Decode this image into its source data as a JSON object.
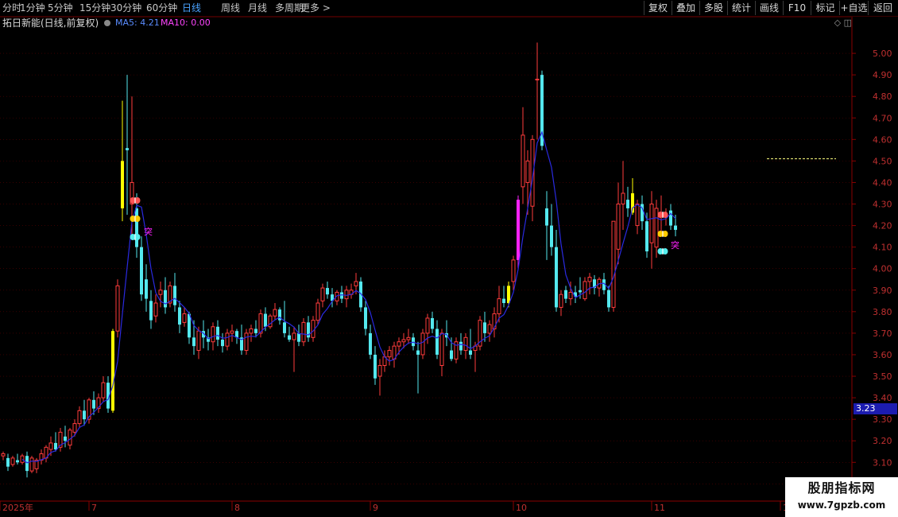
{
  "toolbar": {
    "periods": [
      "分时",
      "1分钟",
      "5分钟",
      "15分钟",
      "30分钟",
      "60分钟",
      "日线",
      "周线",
      "月线",
      "多周期",
      "更多 >"
    ],
    "active_period": "日线",
    "right_buttons": [
      "复权",
      "叠加",
      "多股",
      "统计",
      "画线",
      "F10",
      "标记",
      "+自选",
      "返回"
    ]
  },
  "info": {
    "stock_name": "拓日新能(日线,前复权)",
    "ma5_label": "MA5: 4.21",
    "ma10_label": "MA10: 0.00"
  },
  "window_controls": "◇ ◫",
  "current_price": "3.23",
  "colors": {
    "up": "#ff3c3c",
    "down": "#54e8ee",
    "ma5": "#2a2ae0",
    "signal": "#ffff00",
    "magenta": "#ff22ff",
    "axis": "#8a0000",
    "label": "#c03030",
    "grid": "#5a0000"
  },
  "icons": [
    "butterfly-icon-red",
    "butterfly-icon-yellow",
    "butterfly-icon-cyan"
  ],
  "signal_text": "突",
  "watermark": {
    "line1": "股朋指标网",
    "line2": "www.7gpzb.com"
  },
  "chart_data": {
    "type": "candlestick",
    "y_axis": {
      "min": 2.92,
      "max": 5.1,
      "ticks": [
        3.0,
        3.1,
        3.2,
        3.3,
        3.4,
        3.5,
        3.6,
        3.7,
        3.8,
        3.9,
        4.0,
        4.1,
        4.2,
        4.3,
        4.4,
        4.5,
        4.6,
        4.7,
        4.8,
        4.9,
        5.0
      ]
    },
    "x_axis": {
      "labels": [
        "2025年",
        "7",
        "8",
        "9",
        "10",
        "11",
        "12"
      ],
      "label_index": [
        0,
        18,
        48,
        77,
        107,
        136,
        163
      ]
    },
    "dashed_high_line": 4.51,
    "candles": [
      [
        3.13,
        3.15,
        3.11,
        3.14
      ],
      [
        3.12,
        3.14,
        3.06,
        3.08
      ],
      [
        3.09,
        3.13,
        3.08,
        3.12
      ],
      [
        3.11,
        3.14,
        3.09,
        3.1
      ],
      [
        3.1,
        3.14,
        3.09,
        3.13
      ],
      [
        3.13,
        3.15,
        3.03,
        3.06
      ],
      [
        3.06,
        3.13,
        3.05,
        3.12
      ],
      [
        3.07,
        3.12,
        3.05,
        3.11
      ],
      [
        3.11,
        3.16,
        3.09,
        3.14
      ],
      [
        3.12,
        3.18,
        3.1,
        3.17
      ],
      [
        3.16,
        3.22,
        3.13,
        3.19
      ],
      [
        3.19,
        3.24,
        3.15,
        3.16
      ],
      [
        3.17,
        3.26,
        3.15,
        3.24
      ],
      [
        3.22,
        3.27,
        3.17,
        3.2
      ],
      [
        3.18,
        3.26,
        3.16,
        3.25
      ],
      [
        3.24,
        3.3,
        3.22,
        3.28
      ],
      [
        3.28,
        3.36,
        3.26,
        3.34
      ],
      [
        3.34,
        3.39,
        3.27,
        3.3
      ],
      [
        3.3,
        3.4,
        3.28,
        3.39
      ],
      [
        3.39,
        3.43,
        3.32,
        3.35
      ],
      [
        3.35,
        3.42,
        3.33,
        3.4
      ],
      [
        3.4,
        3.5,
        3.38,
        3.47
      ],
      [
        3.47,
        3.5,
        3.33,
        3.35
      ],
      [
        3.34,
        3.72,
        3.33,
        3.71
      ],
      [
        3.71,
        3.95,
        3.68,
        3.92
      ],
      [
        4.28,
        4.78,
        4.22,
        4.5
      ],
      [
        4.56,
        4.9,
        4.25,
        4.55
      ],
      [
        4.3,
        4.8,
        4.15,
        4.4
      ],
      [
        4.28,
        4.35,
        4.05,
        4.1
      ],
      [
        4.1,
        4.15,
        3.85,
        3.88
      ],
      [
        3.95,
        4.02,
        3.8,
        3.86
      ],
      [
        3.85,
        3.9,
        3.72,
        3.76
      ],
      [
        3.78,
        3.88,
        3.75,
        3.84
      ],
      [
        3.88,
        3.94,
        3.82,
        3.9
      ],
      [
        3.9,
        3.96,
        3.79,
        3.82
      ],
      [
        3.84,
        3.94,
        3.82,
        3.92
      ],
      [
        3.92,
        3.98,
        3.8,
        3.83
      ],
      [
        3.82,
        3.85,
        3.7,
        3.74
      ],
      [
        3.75,
        3.82,
        3.73,
        3.79
      ],
      [
        3.79,
        3.8,
        3.65,
        3.68
      ],
      [
        3.68,
        3.76,
        3.6,
        3.64
      ],
      [
        3.62,
        3.73,
        3.58,
        3.71
      ],
      [
        3.71,
        3.76,
        3.63,
        3.68
      ],
      [
        3.68,
        3.72,
        3.62,
        3.66
      ],
      [
        3.66,
        3.75,
        3.62,
        3.73
      ],
      [
        3.73,
        3.76,
        3.64,
        3.67
      ],
      [
        3.67,
        3.7,
        3.61,
        3.64
      ],
      [
        3.64,
        3.72,
        3.62,
        3.7
      ],
      [
        3.7,
        3.74,
        3.66,
        3.71
      ],
      [
        3.71,
        3.72,
        3.65,
        3.68
      ],
      [
        3.68,
        3.74,
        3.6,
        3.62
      ],
      [
        3.62,
        3.72,
        3.6,
        3.7
      ],
      [
        3.7,
        3.74,
        3.66,
        3.72
      ],
      [
        3.72,
        3.76,
        3.68,
        3.7
      ],
      [
        3.7,
        3.81,
        3.68,
        3.79
      ],
      [
        3.79,
        3.82,
        3.71,
        3.73
      ],
      [
        3.73,
        3.79,
        3.72,
        3.78
      ],
      [
        3.78,
        3.84,
        3.76,
        3.81
      ],
      [
        3.81,
        3.82,
        3.74,
        3.76
      ],
      [
        3.75,
        3.85,
        3.68,
        3.7
      ],
      [
        3.69,
        3.73,
        3.66,
        3.67
      ],
      [
        3.67,
        3.73,
        3.52,
        3.7
      ],
      [
        3.7,
        3.74,
        3.64,
        3.66
      ],
      [
        3.66,
        3.77,
        3.64,
        3.75
      ],
      [
        3.75,
        3.78,
        3.66,
        3.68
      ],
      [
        3.68,
        3.78,
        3.66,
        3.76
      ],
      [
        3.76,
        3.86,
        3.74,
        3.84
      ],
      [
        3.85,
        3.93,
        3.82,
        3.91
      ],
      [
        3.91,
        3.94,
        3.86,
        3.88
      ],
      [
        3.88,
        3.91,
        3.82,
        3.85
      ],
      [
        3.85,
        3.9,
        3.83,
        3.89
      ],
      [
        3.89,
        3.92,
        3.84,
        3.86
      ],
      [
        3.86,
        3.92,
        3.82,
        3.9
      ],
      [
        3.88,
        3.93,
        3.86,
        3.9
      ],
      [
        3.92,
        3.98,
        3.88,
        3.94
      ],
      [
        3.94,
        3.96,
        3.8,
        3.82
      ],
      [
        3.82,
        3.85,
        3.69,
        3.72
      ],
      [
        3.7,
        3.74,
        3.58,
        3.6
      ],
      [
        3.6,
        3.64,
        3.46,
        3.49
      ],
      [
        3.5,
        3.58,
        3.41,
        3.55
      ],
      [
        3.55,
        3.62,
        3.52,
        3.59
      ],
      [
        3.59,
        3.64,
        3.55,
        3.62
      ],
      [
        3.58,
        3.66,
        3.54,
        3.64
      ],
      [
        3.64,
        3.68,
        3.6,
        3.66
      ],
      [
        3.66,
        3.7,
        3.63,
        3.67
      ],
      [
        3.67,
        3.72,
        3.65,
        3.68
      ],
      [
        3.68,
        3.7,
        3.62,
        3.64
      ],
      [
        3.62,
        3.66,
        3.42,
        3.6
      ],
      [
        3.6,
        3.72,
        3.58,
        3.7
      ],
      [
        3.7,
        3.79,
        3.65,
        3.77
      ],
      [
        3.77,
        3.8,
        3.7,
        3.72
      ],
      [
        3.72,
        3.76,
        3.58,
        3.6
      ],
      [
        3.55,
        3.72,
        3.5,
        3.7
      ],
      [
        3.7,
        3.76,
        3.64,
        3.68
      ],
      [
        3.62,
        3.68,
        3.57,
        3.58
      ],
      [
        3.58,
        3.68,
        3.56,
        3.66
      ],
      [
        3.66,
        3.7,
        3.6,
        3.62
      ],
      [
        3.62,
        3.7,
        3.58,
        3.68
      ],
      [
        3.62,
        3.72,
        3.58,
        3.6
      ],
      [
        3.62,
        3.66,
        3.52,
        3.64
      ],
      [
        3.64,
        3.78,
        3.62,
        3.76
      ],
      [
        3.75,
        3.8,
        3.66,
        3.7
      ],
      [
        3.7,
        3.76,
        3.66,
        3.74
      ],
      [
        3.72,
        3.82,
        3.68,
        3.79
      ],
      [
        3.79,
        3.92,
        3.75,
        3.86
      ],
      [
        3.86,
        3.92,
        3.82,
        3.84
      ],
      [
        3.84,
        3.94,
        3.82,
        3.92
      ],
      [
        3.94,
        4.06,
        3.9,
        4.04
      ],
      [
        4.04,
        4.34,
        4.0,
        4.32
      ],
      [
        4.38,
        4.75,
        4.3,
        4.62
      ],
      [
        4.4,
        4.55,
        4.25,
        4.5
      ],
      [
        4.29,
        4.62,
        4.22,
        4.6
      ],
      [
        4.88,
        5.05,
        4.6,
        4.88
      ],
      [
        4.9,
        4.92,
        4.55,
        4.57
      ],
      [
        4.28,
        4.36,
        4.04,
        4.2
      ],
      [
        4.2,
        4.3,
        4.06,
        4.1
      ],
      [
        4.1,
        4.18,
        3.8,
        3.82
      ],
      [
        3.82,
        3.9,
        3.78,
        3.88
      ],
      [
        3.9,
        3.92,
        3.84,
        3.86
      ],
      [
        3.86,
        3.94,
        3.83,
        3.89
      ],
      [
        3.89,
        3.92,
        3.84,
        3.87
      ],
      [
        3.9,
        3.96,
        3.86,
        3.89
      ],
      [
        3.86,
        3.96,
        3.85,
        3.94
      ],
      [
        3.94,
        3.98,
        3.88,
        3.96
      ],
      [
        3.95,
        3.97,
        3.88,
        3.91
      ],
      [
        3.91,
        3.96,
        3.87,
        3.95
      ],
      [
        3.95,
        3.98,
        3.88,
        3.9
      ],
      [
        3.9,
        3.92,
        3.8,
        3.82
      ],
      [
        3.82,
        4.22,
        3.8,
        4.22
      ],
      [
        4.09,
        4.4,
        4.02,
        4.3
      ],
      [
        4.3,
        4.5,
        4.18,
        4.35
      ],
      [
        4.32,
        4.38,
        4.24,
        4.28
      ],
      [
        4.35,
        4.42,
        4.25,
        4.26
      ],
      [
        4.2,
        4.32,
        4.16,
        4.3
      ],
      [
        4.3,
        4.34,
        4.18,
        4.22
      ],
      [
        4.22,
        4.26,
        4.05,
        4.08
      ],
      [
        4.12,
        4.36,
        4.0,
        4.3
      ],
      [
        4.1,
        4.32,
        4.05,
        4.28
      ],
      [
        4.24,
        4.34,
        4.15,
        4.25
      ],
      [
        4.24,
        4.28,
        4.2,
        4.25
      ],
      [
        4.27,
        4.3,
        4.18,
        4.2
      ],
      [
        4.2,
        4.25,
        4.15,
        4.18
      ]
    ]
  }
}
